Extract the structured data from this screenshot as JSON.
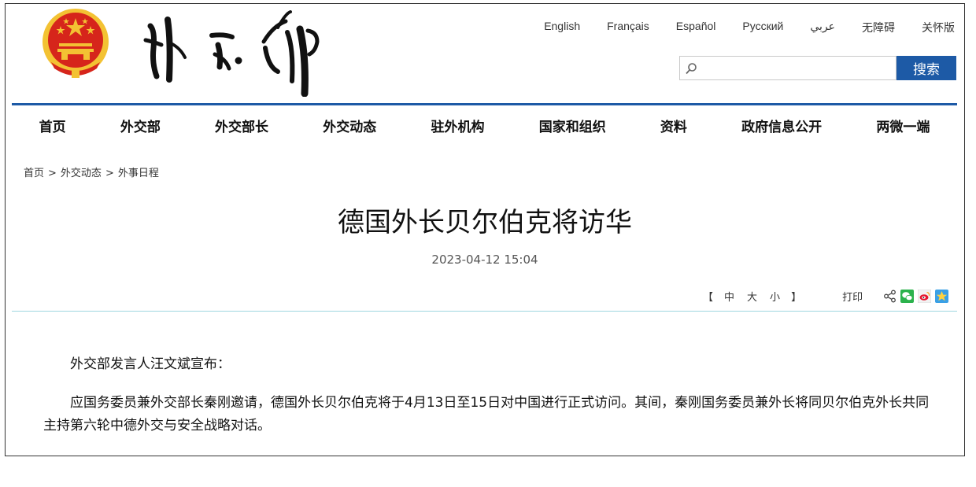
{
  "header": {
    "languages": [
      "English",
      "Français",
      "Español",
      "Русский",
      "عربي",
      "无障碍",
      "关怀版"
    ],
    "search": {
      "placeholder": "",
      "button_label": "搜索"
    }
  },
  "nav": {
    "items": [
      "首页",
      "外交部",
      "外交部长",
      "外交动态",
      "驻外机构",
      "国家和组织",
      "资料",
      "政府信息公开",
      "两微一端"
    ]
  },
  "breadcrumb": {
    "items": [
      "首页",
      "外交动态",
      "外事日程"
    ],
    "separator": ">"
  },
  "article": {
    "title": "德国外长贝尔伯克将访华",
    "date": "2023-04-12 15:04",
    "font_size": {
      "open": "【",
      "options": [
        "中",
        "大",
        "小"
      ],
      "close": "】"
    },
    "print_label": "打印",
    "share_icons": [
      "share-icon",
      "wechat-icon",
      "weibo-icon",
      "qzone-icon"
    ],
    "paragraphs": [
      "外交部发言人汪文斌宣布：",
      "应国务委员兼外交部长秦刚邀请，德国外长贝尔伯克将于4月13日至15日对中国进行正式访问。其间，秦刚国务委员兼外长将同贝尔伯克外长共同主持第六轮中德外交与安全战略对话。"
    ]
  },
  "colors": {
    "accent": "#1d5aa6",
    "divider": "#9fd6df",
    "emblem_red": "#d6251b",
    "emblem_gold": "#f3c233"
  }
}
